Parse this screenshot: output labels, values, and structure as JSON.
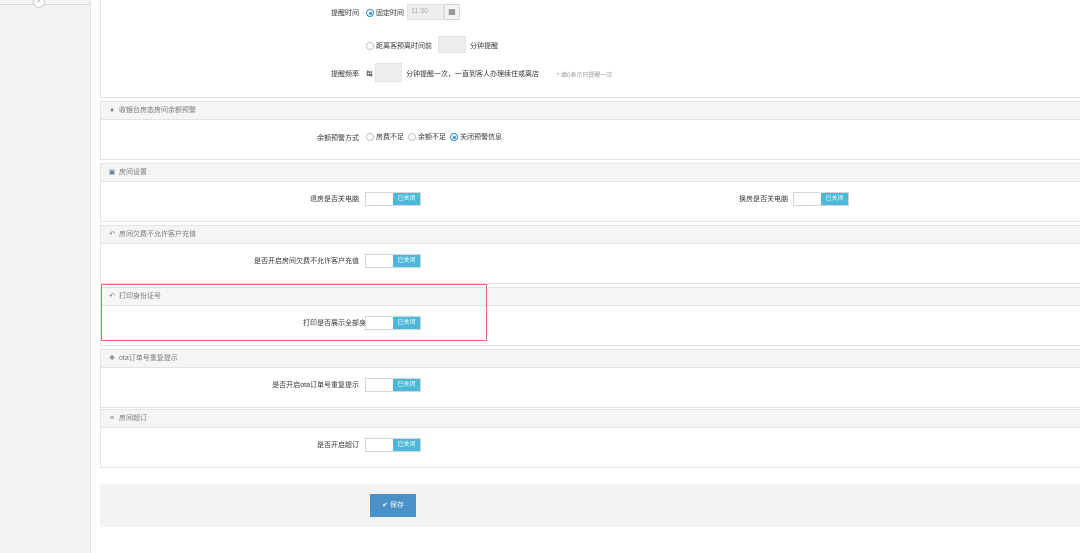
{
  "sidebar": {
    "collapse_icon": "«"
  },
  "reminder": {
    "time_label": "提醒时间",
    "fixed_label": "固定时间",
    "fixed_value": "11:30",
    "calendar_icon": "calendar-icon",
    "before_label": "距离客预离时间前",
    "before_suffix": "分钟提醒",
    "freq_label": "提醒频率",
    "freq_prefix": "每",
    "freq_suffix": "分钟提醒一次，一直到客人办理续住或离店",
    "freq_hint": "* 填0表示只提醒一次"
  },
  "balance": {
    "title": "收银台房态房间余额预警",
    "icon": "bell-icon",
    "mode_label": "余额预警方式",
    "options": [
      "房费不足",
      "余额不足",
      "关闭预警信息"
    ]
  },
  "room": {
    "title": "房间设置",
    "icon": "monitor-icon",
    "checkout_label": "退房是否关电脑",
    "swap_label": "换房是否关电脑",
    "state": "已关闭"
  },
  "arrears": {
    "title": "房间欠费不允许客户充值",
    "icon": "reply-icon",
    "label": "是否开启房间欠费不允许客户充值",
    "state": "已关闭"
  },
  "idprint": {
    "title": "打印身份证号",
    "icon": "reply-icon",
    "label": "打印是否展示全部身份证号",
    "state": "已关闭"
  },
  "ota": {
    "title": "ota订单号重复提示",
    "icon": "info-icon",
    "label": "是否开启ota订单号重复提示",
    "state": "已关闭"
  },
  "overbook": {
    "title": "房间超订",
    "icon": "list-icon",
    "label": "是否开启超订",
    "state": "已关闭"
  },
  "save": {
    "label": "保存",
    "icon": "check-icon"
  },
  "colors": {
    "accent": "#2f8fd8",
    "toggle_on": "#4bb8d7",
    "save": "#4a90c9",
    "highlight": "#e06a6a"
  }
}
